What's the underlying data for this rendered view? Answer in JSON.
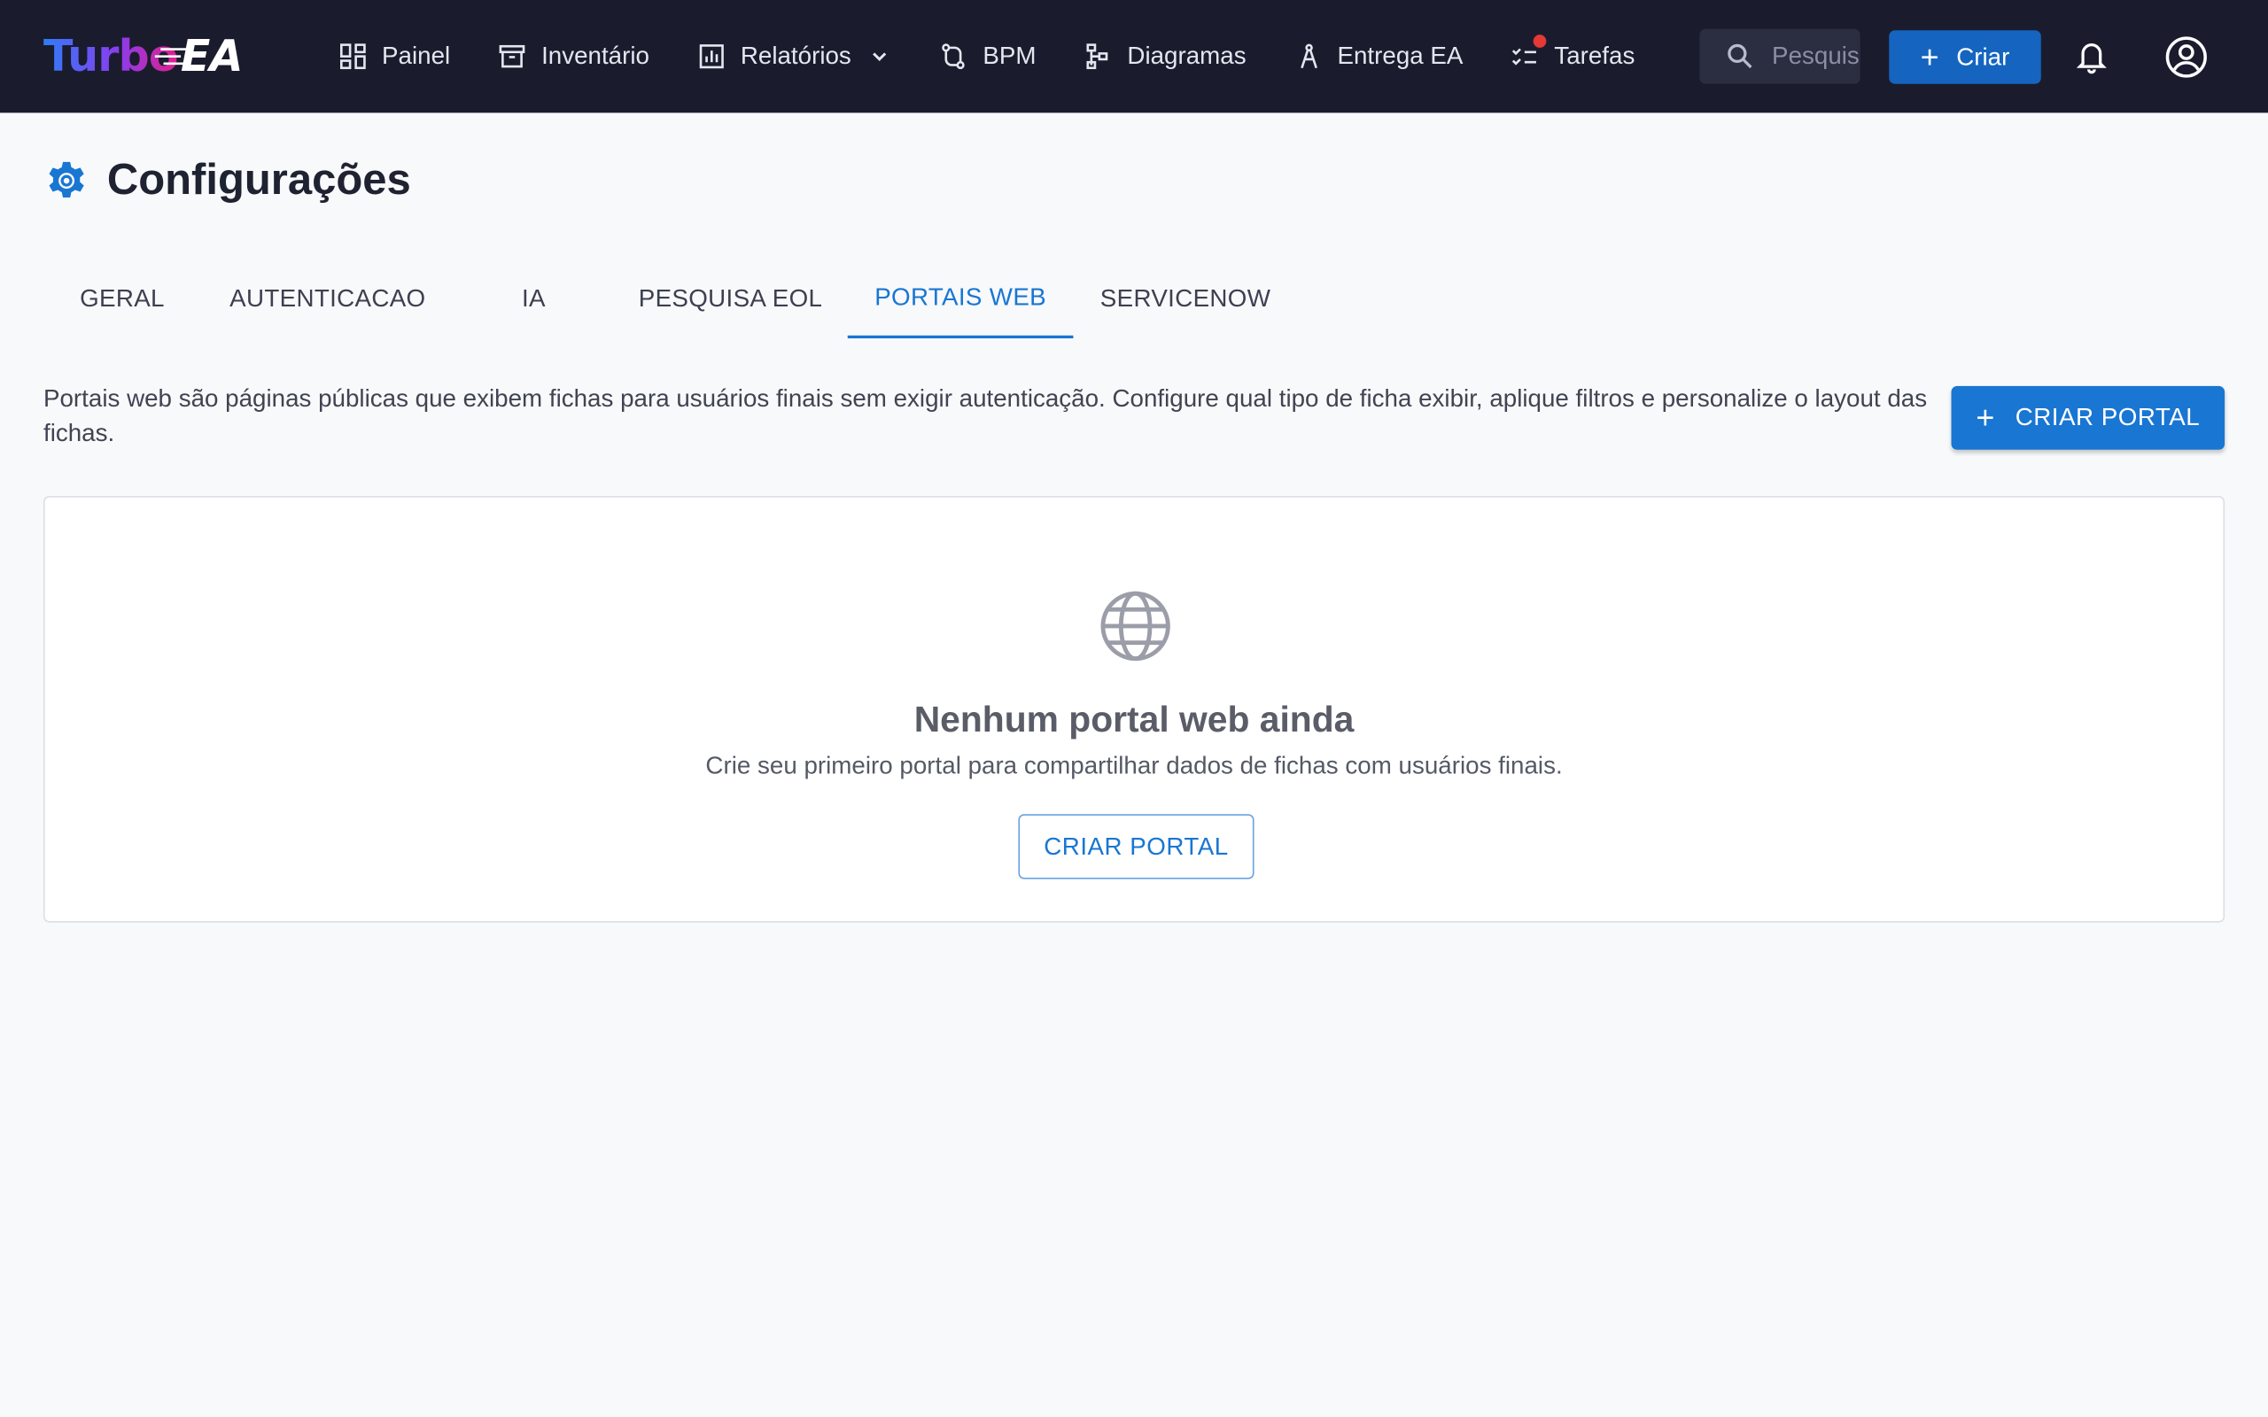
{
  "app": {
    "logo_part1": "Turbo",
    "logo_part2": "EA"
  },
  "nav": {
    "items": [
      {
        "label": "Painel",
        "icon": "dashboard-icon"
      },
      {
        "label": "Inventário",
        "icon": "archive-icon"
      },
      {
        "label": "Relatórios",
        "icon": "report-icon"
      },
      {
        "label": "BPM",
        "icon": "route-icon"
      },
      {
        "label": "Diagramas",
        "icon": "diagram-icon"
      },
      {
        "label": "Entrega EA",
        "icon": "compass-icon"
      },
      {
        "label": "Tarefas",
        "icon": "checklist-icon"
      }
    ],
    "search_placeholder": "Pesquisar",
    "create_label": "Criar"
  },
  "page": {
    "title": "Configurações",
    "tabs": [
      "GERAL",
      "AUTENTICACAO",
      "IA",
      "PESQUISA EOL",
      "PORTAIS WEB",
      "SERVICENOW"
    ],
    "active_tab": "PORTAIS WEB",
    "description": "Portais web são páginas públicas que exibem fichas para usuários finais sem exigir autenticação. Configure qual tipo de ficha exibir, aplique filtros e personalize o layout das fichas.",
    "create_portal_label": "CRIAR PORTAL"
  },
  "empty_state": {
    "title": "Nenhum portal web ainda",
    "subtitle": "Crie seu primeiro portal para compartilhar dados de fichas com usuários finais.",
    "button_label": "CRIAR PORTAL"
  },
  "colors": {
    "topbar": "#1a1c2e",
    "accent": "#1976d2",
    "notification_dot": "#e53935"
  }
}
